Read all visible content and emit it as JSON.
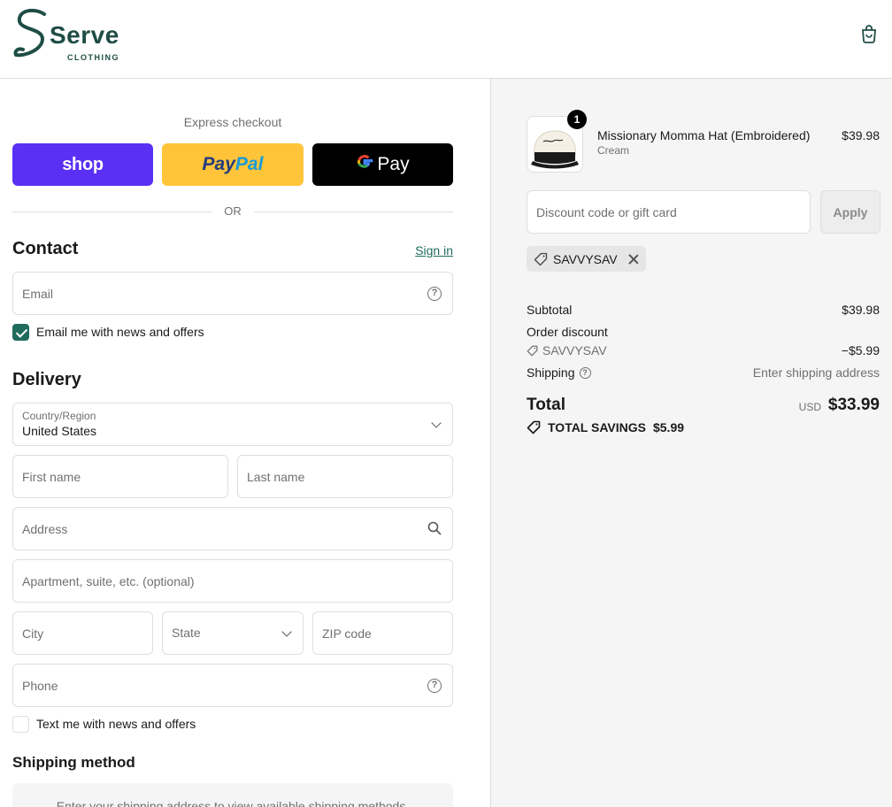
{
  "header": {
    "brand_name": "Serve",
    "brand_sub": "CLOTHING",
    "cart_icon": "shopping-bag-icon"
  },
  "express": {
    "label": "Express checkout",
    "shop_label": "shop",
    "paypal_part1": "Pay",
    "paypal_part2": "Pal",
    "gpay_g": "G",
    "gpay_label": "Pay",
    "or_label": "OR"
  },
  "contact": {
    "title": "Contact",
    "sign_in": "Sign in",
    "email_placeholder": "Email",
    "email_news_label": "Email me with news and offers",
    "email_news_checked": true
  },
  "delivery": {
    "title": "Delivery",
    "country_label": "Country/Region",
    "country_value": "United States",
    "first_name_placeholder": "First name",
    "last_name_placeholder": "Last name",
    "address_placeholder": "Address",
    "apartment_placeholder": "Apartment, suite, etc. (optional)",
    "city_placeholder": "City",
    "state_placeholder": "State",
    "zip_placeholder": "ZIP code",
    "phone_placeholder": "Phone",
    "text_news_label": "Text me with news and offers",
    "text_news_checked": false
  },
  "shipping_method": {
    "title": "Shipping method",
    "empty_message": "Enter your shipping address to view available shipping methods."
  },
  "summary": {
    "product": {
      "name": "Missionary Momma Hat (Embroidered)",
      "variant": "Cream",
      "price": "$39.98",
      "quantity": "1"
    },
    "discount_placeholder": "Discount code or gift card",
    "apply_label": "Apply",
    "applied_code": "SAVVYSAV",
    "subtotal_label": "Subtotal",
    "subtotal_value": "$39.98",
    "order_discount_label": "Order discount",
    "order_discount_code": "SAVVYSAV",
    "order_discount_value": "−$5.99",
    "shipping_label": "Shipping",
    "shipping_value": "Enter shipping address",
    "total_label": "Total",
    "total_currency": "USD",
    "total_value": "$33.99",
    "savings_label": "TOTAL SAVINGS",
    "savings_value": "$5.99"
  },
  "colors": {
    "accent": "#1f6b5c",
    "shop_purple": "#5a31f4",
    "paypal_yellow": "#ffc439"
  }
}
